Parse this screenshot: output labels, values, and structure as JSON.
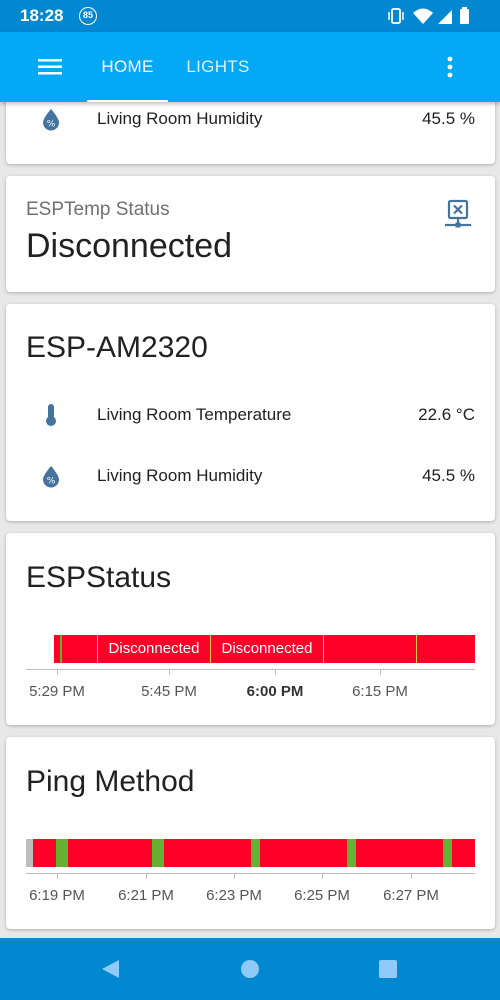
{
  "status_bar": {
    "time": "18:28",
    "notification_badge": "85",
    "icons": [
      "vibrate-icon",
      "wifi-icon",
      "signal-icon",
      "battery-icon"
    ]
  },
  "toolbar": {
    "tabs": [
      {
        "label": "HOME",
        "active": true
      },
      {
        "label": "LIGHTS",
        "active": false
      }
    ]
  },
  "top_card": {
    "row": {
      "icon": "humidity-icon",
      "name": "Living Room Humidity",
      "value": "45.5 %"
    }
  },
  "esptemp_status": {
    "label": "ESPTemp Status",
    "value": "Disconnected",
    "icon": "network-disconnected-icon"
  },
  "esp_am2320": {
    "title": "ESP-AM2320",
    "rows": [
      {
        "icon": "thermometer-icon",
        "name": "Living Room Temperature",
        "value": "22.6 °C"
      },
      {
        "icon": "humidity-icon",
        "name": "Living Room Humidity",
        "value": "45.5 %"
      }
    ]
  },
  "espstatus": {
    "title": "ESPStatus",
    "segment_labels": [
      "Disconnected",
      "Disconnected"
    ],
    "ticks": [
      {
        "label": "5:29 PM",
        "bold": false
      },
      {
        "label": "5:45 PM",
        "bold": false
      },
      {
        "label": "6:00 PM",
        "bold": true
      },
      {
        "label": "6:15 PM",
        "bold": false
      }
    ]
  },
  "ping_method": {
    "title": "Ping Method",
    "ticks": [
      "6:19 PM",
      "6:21 PM",
      "6:23 PM",
      "6:25 PM",
      "6:27 PM"
    ]
  },
  "colors": {
    "accent": "#03a9f4",
    "status_bar": "#0288d1",
    "timeline_off": "#ff0029",
    "timeline_on": "#66b032",
    "timeline_unknown": "#bdbdbd"
  }
}
